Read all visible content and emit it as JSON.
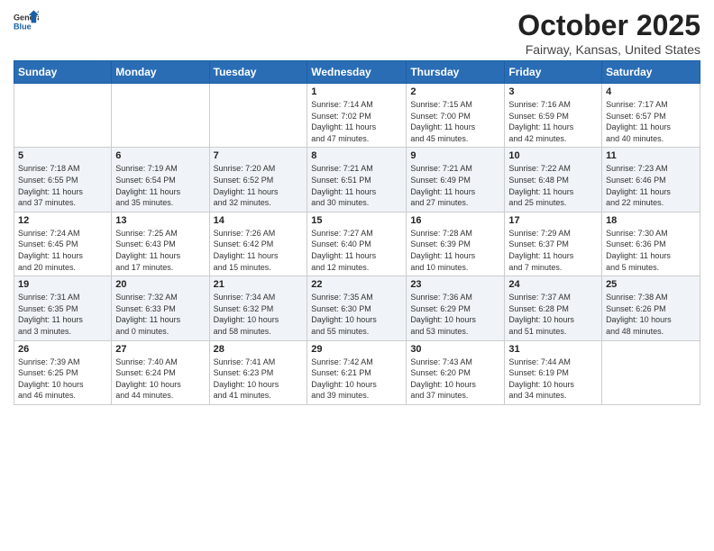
{
  "logo": {
    "general": "General",
    "blue": "Blue"
  },
  "title": "October 2025",
  "location": "Fairway, Kansas, United States",
  "days_of_week": [
    "Sunday",
    "Monday",
    "Tuesday",
    "Wednesday",
    "Thursday",
    "Friday",
    "Saturday"
  ],
  "weeks": [
    [
      {
        "day": "",
        "info": ""
      },
      {
        "day": "",
        "info": ""
      },
      {
        "day": "",
        "info": ""
      },
      {
        "day": "1",
        "info": "Sunrise: 7:14 AM\nSunset: 7:02 PM\nDaylight: 11 hours\nand 47 minutes."
      },
      {
        "day": "2",
        "info": "Sunrise: 7:15 AM\nSunset: 7:00 PM\nDaylight: 11 hours\nand 45 minutes."
      },
      {
        "day": "3",
        "info": "Sunrise: 7:16 AM\nSunset: 6:59 PM\nDaylight: 11 hours\nand 42 minutes."
      },
      {
        "day": "4",
        "info": "Sunrise: 7:17 AM\nSunset: 6:57 PM\nDaylight: 11 hours\nand 40 minutes."
      }
    ],
    [
      {
        "day": "5",
        "info": "Sunrise: 7:18 AM\nSunset: 6:55 PM\nDaylight: 11 hours\nand 37 minutes."
      },
      {
        "day": "6",
        "info": "Sunrise: 7:19 AM\nSunset: 6:54 PM\nDaylight: 11 hours\nand 35 minutes."
      },
      {
        "day": "7",
        "info": "Sunrise: 7:20 AM\nSunset: 6:52 PM\nDaylight: 11 hours\nand 32 minutes."
      },
      {
        "day": "8",
        "info": "Sunrise: 7:21 AM\nSunset: 6:51 PM\nDaylight: 11 hours\nand 30 minutes."
      },
      {
        "day": "9",
        "info": "Sunrise: 7:21 AM\nSunset: 6:49 PM\nDaylight: 11 hours\nand 27 minutes."
      },
      {
        "day": "10",
        "info": "Sunrise: 7:22 AM\nSunset: 6:48 PM\nDaylight: 11 hours\nand 25 minutes."
      },
      {
        "day": "11",
        "info": "Sunrise: 7:23 AM\nSunset: 6:46 PM\nDaylight: 11 hours\nand 22 minutes."
      }
    ],
    [
      {
        "day": "12",
        "info": "Sunrise: 7:24 AM\nSunset: 6:45 PM\nDaylight: 11 hours\nand 20 minutes."
      },
      {
        "day": "13",
        "info": "Sunrise: 7:25 AM\nSunset: 6:43 PM\nDaylight: 11 hours\nand 17 minutes."
      },
      {
        "day": "14",
        "info": "Sunrise: 7:26 AM\nSunset: 6:42 PM\nDaylight: 11 hours\nand 15 minutes."
      },
      {
        "day": "15",
        "info": "Sunrise: 7:27 AM\nSunset: 6:40 PM\nDaylight: 11 hours\nand 12 minutes."
      },
      {
        "day": "16",
        "info": "Sunrise: 7:28 AM\nSunset: 6:39 PM\nDaylight: 11 hours\nand 10 minutes."
      },
      {
        "day": "17",
        "info": "Sunrise: 7:29 AM\nSunset: 6:37 PM\nDaylight: 11 hours\nand 7 minutes."
      },
      {
        "day": "18",
        "info": "Sunrise: 7:30 AM\nSunset: 6:36 PM\nDaylight: 11 hours\nand 5 minutes."
      }
    ],
    [
      {
        "day": "19",
        "info": "Sunrise: 7:31 AM\nSunset: 6:35 PM\nDaylight: 11 hours\nand 3 minutes."
      },
      {
        "day": "20",
        "info": "Sunrise: 7:32 AM\nSunset: 6:33 PM\nDaylight: 11 hours\nand 0 minutes."
      },
      {
        "day": "21",
        "info": "Sunrise: 7:34 AM\nSunset: 6:32 PM\nDaylight: 10 hours\nand 58 minutes."
      },
      {
        "day": "22",
        "info": "Sunrise: 7:35 AM\nSunset: 6:30 PM\nDaylight: 10 hours\nand 55 minutes."
      },
      {
        "day": "23",
        "info": "Sunrise: 7:36 AM\nSunset: 6:29 PM\nDaylight: 10 hours\nand 53 minutes."
      },
      {
        "day": "24",
        "info": "Sunrise: 7:37 AM\nSunset: 6:28 PM\nDaylight: 10 hours\nand 51 minutes."
      },
      {
        "day": "25",
        "info": "Sunrise: 7:38 AM\nSunset: 6:26 PM\nDaylight: 10 hours\nand 48 minutes."
      }
    ],
    [
      {
        "day": "26",
        "info": "Sunrise: 7:39 AM\nSunset: 6:25 PM\nDaylight: 10 hours\nand 46 minutes."
      },
      {
        "day": "27",
        "info": "Sunrise: 7:40 AM\nSunset: 6:24 PM\nDaylight: 10 hours\nand 44 minutes."
      },
      {
        "day": "28",
        "info": "Sunrise: 7:41 AM\nSunset: 6:23 PM\nDaylight: 10 hours\nand 41 minutes."
      },
      {
        "day": "29",
        "info": "Sunrise: 7:42 AM\nSunset: 6:21 PM\nDaylight: 10 hours\nand 39 minutes."
      },
      {
        "day": "30",
        "info": "Sunrise: 7:43 AM\nSunset: 6:20 PM\nDaylight: 10 hours\nand 37 minutes."
      },
      {
        "day": "31",
        "info": "Sunrise: 7:44 AM\nSunset: 6:19 PM\nDaylight: 10 hours\nand 34 minutes."
      },
      {
        "day": "",
        "info": ""
      }
    ]
  ]
}
